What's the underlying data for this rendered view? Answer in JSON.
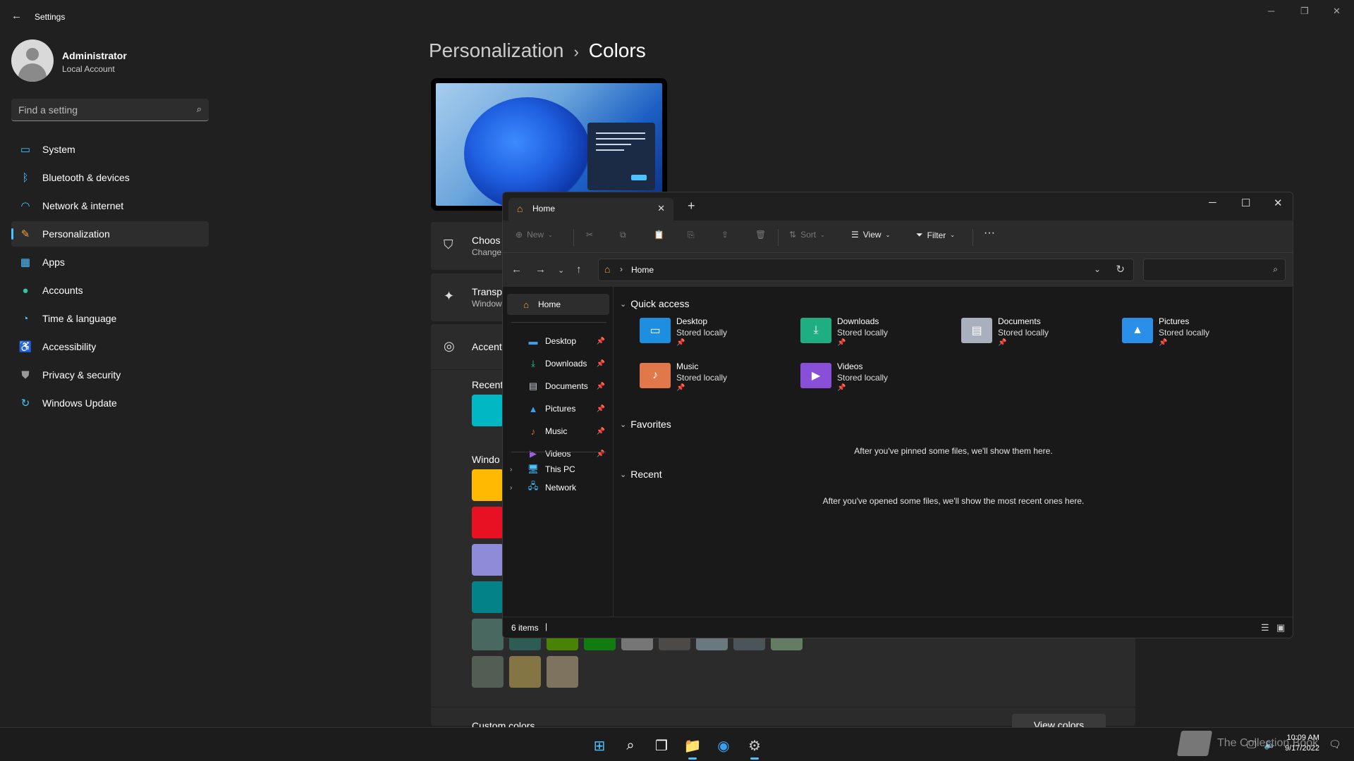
{
  "settings": {
    "title": "Settings",
    "user": {
      "name": "Administrator",
      "role": "Local Account"
    },
    "search_placeholder": "Find a setting",
    "nav": [
      {
        "label": "System",
        "icon": "system-icon",
        "color": "#4cc2ff"
      },
      {
        "label": "Bluetooth & devices",
        "icon": "bluetooth-icon",
        "color": "#4cc2ff"
      },
      {
        "label": "Network & internet",
        "icon": "wifi-icon",
        "color": "#4cc2ff"
      },
      {
        "label": "Personalization",
        "icon": "brush-icon",
        "color": "#f0a140",
        "active": true
      },
      {
        "label": "Apps",
        "icon": "apps-icon",
        "color": "#4cc2ff"
      },
      {
        "label": "Accounts",
        "icon": "person-icon",
        "color": "#2fc99e"
      },
      {
        "label": "Time & language",
        "icon": "clock-globe-icon",
        "color": "#4cc2ff"
      },
      {
        "label": "Accessibility",
        "icon": "accessibility-icon",
        "color": "#4cc2ff"
      },
      {
        "label": "Privacy & security",
        "icon": "shield-icon",
        "color": "#9a9a9a"
      },
      {
        "label": "Windows Update",
        "icon": "update-icon",
        "color": "#4cc2ff"
      }
    ],
    "breadcrumb": {
      "parent": "Personalization",
      "separator": "›",
      "current": "Colors"
    },
    "cards": {
      "mode": {
        "title": "Choos",
        "sub": "Change"
      },
      "transparency": {
        "title": "Transp",
        "sub": "Window"
      },
      "accent": {
        "title": "Accent"
      }
    },
    "sections": {
      "recent": "Recent",
      "windows": "Windo",
      "custom": "Custom colors"
    },
    "view_colors": "View colors",
    "recent_colors": [
      "#00b7c3"
    ],
    "windows_colors": [
      "#ffb900",
      "#e81123",
      "#8e8cd8",
      "#038387",
      "#486860",
      "#2d5c55",
      "#498205",
      "#107c10",
      "#767676",
      "#4c4a48",
      "#69797e",
      "#4a5459",
      "#647c64",
      "#525e54",
      "#847545",
      "#7e735f"
    ]
  },
  "explorer": {
    "tab": "Home",
    "toolbar": {
      "new": "New",
      "sort": "Sort",
      "view": "View",
      "filter": "Filter",
      "more": "···"
    },
    "address": "Home",
    "sidebar": {
      "home": "Home",
      "pinned": [
        {
          "label": "Desktop",
          "icon": "desktop-folder-icon",
          "color": "#3aa0f0"
        },
        {
          "label": "Downloads",
          "icon": "download-icon",
          "color": "#2fc99e"
        },
        {
          "label": "Documents",
          "icon": "documents-icon",
          "color": "#c8ccd4"
        },
        {
          "label": "Pictures",
          "icon": "pictures-icon",
          "color": "#3aa0f0"
        },
        {
          "label": "Music",
          "icon": "music-icon",
          "color": "#e86a4a"
        },
        {
          "label": "Videos",
          "icon": "videos-icon",
          "color": "#9b5de5"
        }
      ],
      "this_pc": "This PC",
      "network": "Network"
    },
    "quick_access_title": "Quick access",
    "quick_access": [
      {
        "name": "Desktop",
        "status": "Stored locally",
        "color": "#1e8fe0"
      },
      {
        "name": "Downloads",
        "status": "Stored locally",
        "color": "#1fae82"
      },
      {
        "name": "Documents",
        "status": "Stored locally",
        "color": "#a9b0bd"
      },
      {
        "name": "Pictures",
        "status": "Stored locally",
        "color": "#2a8fe8"
      },
      {
        "name": "Music",
        "status": "Stored locally",
        "color": "#e0784a"
      },
      {
        "name": "Videos",
        "status": "Stored locally",
        "color": "#8a4fd8"
      }
    ],
    "favorites_title": "Favorites",
    "favorites_msg": "After you've pinned some files, we'll show them here.",
    "recent_title": "Recent",
    "recent_msg": "After you've opened some files, we'll show the most recent ones here.",
    "status": "6 items"
  },
  "taskbar": {
    "watermark": "The Collection Book",
    "time": "10:09 AM",
    "date": "9/17/2022"
  }
}
